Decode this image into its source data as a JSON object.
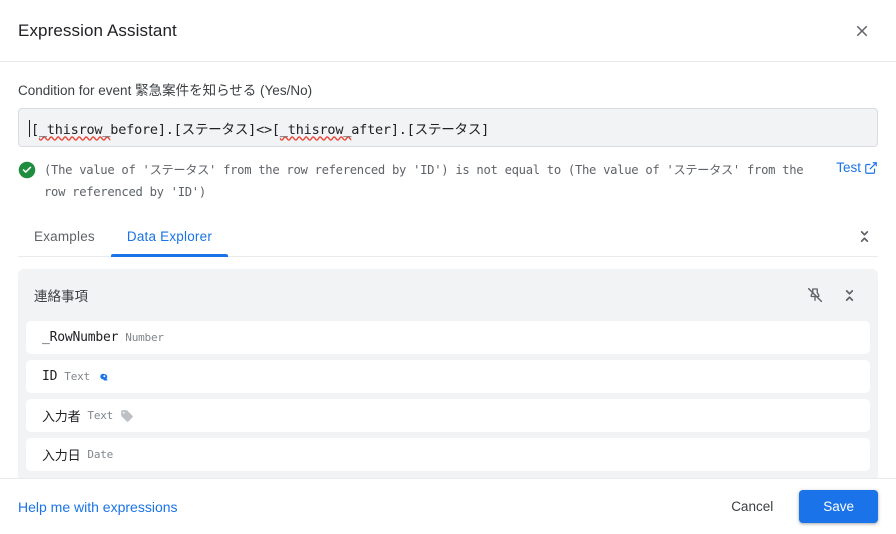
{
  "header": {
    "title": "Expression Assistant",
    "close_icon": "close-icon"
  },
  "expression_editor": {
    "label": "Condition for event 緊急案件を知らせる (Yes/No)",
    "value": "[_thisrow_before].[ステータス]<>[_thisrow_after].[ステータス]",
    "segments": [
      {
        "text": "[",
        "squiggly": false
      },
      {
        "text": "_thisrow_",
        "squiggly": true
      },
      {
        "text": "before].[ステータス]<>[",
        "squiggly": false
      },
      {
        "text": "_thisrow_",
        "squiggly": true
      },
      {
        "text": "after].[ステータス]",
        "squiggly": false
      }
    ],
    "caret_visible": true
  },
  "validation": {
    "status_icon": "check-circle-icon",
    "status": "valid",
    "status_color": "#1e8e3e",
    "message": "(The value of 'ステータス' from the row referenced by 'ID') is not equal to (The value of 'ステータス' from the row referenced by 'ID')",
    "test_label": "Test",
    "test_icon": "open-in-new-icon"
  },
  "tabs": {
    "items": [
      {
        "label": "Examples",
        "active": false
      },
      {
        "label": "Data Explorer",
        "active": true
      }
    ],
    "collapse_icon": "unfold-less-icon",
    "active_color": "#1a73e8"
  },
  "data_explorer": {
    "table_name": "連絡事項",
    "pin_icon": "pin-off-icon",
    "collapse_icon": "unfold-less-icon",
    "fields": [
      {
        "name": "_RowNumber",
        "type": "Number",
        "badge": null,
        "jp": false
      },
      {
        "name": "ID",
        "type": "Text",
        "badge": "key-icon",
        "jp": false
      },
      {
        "name": "入力者",
        "type": "Text",
        "badge": "tag-icon",
        "jp": true
      },
      {
        "name": "入力日",
        "type": "Date",
        "badge": null,
        "jp": true
      }
    ]
  },
  "footer": {
    "help_label": "Help me with expressions",
    "cancel_label": "Cancel",
    "save_label": "Save",
    "save_color": "#1a73e8"
  }
}
